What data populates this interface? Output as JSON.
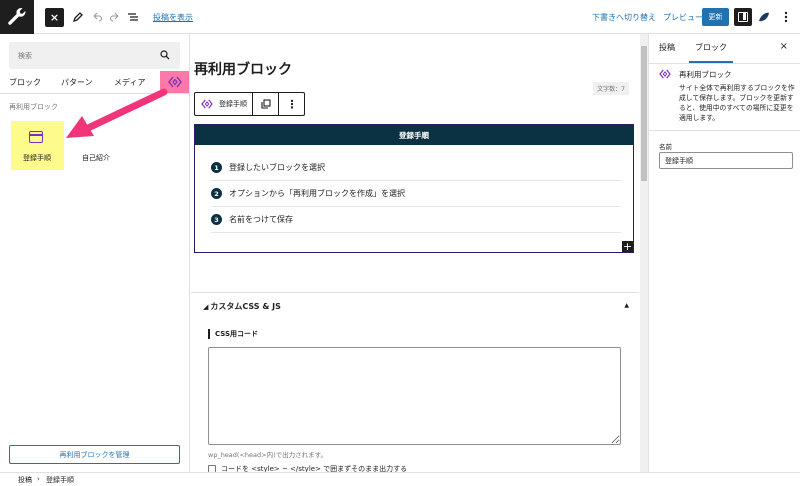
{
  "topbar": {
    "close_label": "×",
    "view_post_link": "投稿を表示",
    "save_draft": "下書きへ切り替え",
    "preview": "プレビュー",
    "update": "更新"
  },
  "inserter": {
    "search_placeholder": "検索",
    "tabs": [
      "ブロック",
      "パターン",
      "メディア"
    ],
    "section_label": "再利用ブロック",
    "items": [
      {
        "label": "登録手順"
      },
      {
        "label": "自己紹介"
      }
    ],
    "manage_button": "再利用ブロックを管理"
  },
  "canvas": {
    "post_title": "再利用ブロック",
    "word_count": "文字数：7",
    "toolbar_block_label": "登録手順",
    "toolbar_more": "⋮",
    "card_title": "登録手順",
    "steps": [
      {
        "num": "1",
        "text": "登録したいブロックを選択"
      },
      {
        "num": "2",
        "text": "オプションから「再利用ブロックを作成」を選択"
      },
      {
        "num": "3",
        "text": "名前をつけて保存"
      }
    ],
    "add_block": "+"
  },
  "css_panel": {
    "title": "カスタムCSS & JS",
    "toggle": "▲",
    "css_label": "CSS用コード",
    "help_text": "wp_head(<head>内)で出力されます。",
    "checkbox_label": "コードを <style> ~ </style> で囲まずそのまま出力する"
  },
  "sidebar": {
    "tabs": [
      "投稿",
      "ブロック"
    ],
    "close": "×",
    "block_title": "再利用ブロック",
    "block_description": "サイト全体で再利用するブロックを作成して保存します。ブロックを更新すると、使用中のすべての場所に変更を適用します。",
    "name_label": "名前",
    "name_value": "登録手順"
  },
  "footer": {
    "crumbs": [
      "投稿",
      "›",
      "登録手順"
    ]
  },
  "colors": {
    "accent": "#2271b1",
    "card_header": "#0b3242",
    "highlight": "#fdfb8c",
    "pink": "#ff79a8",
    "arrow": "#f0357a",
    "reusable_icon": "#7b2fbf"
  }
}
